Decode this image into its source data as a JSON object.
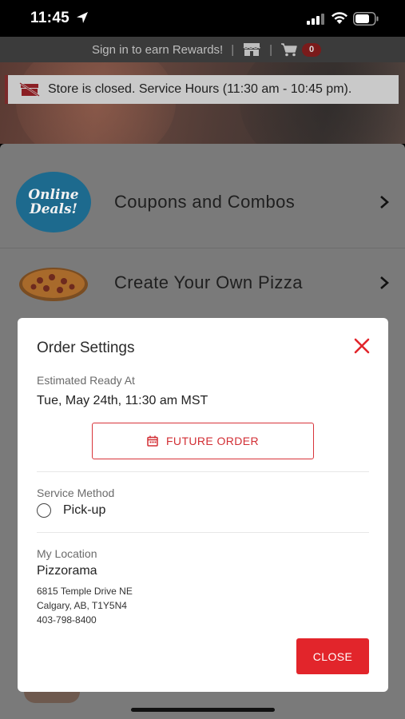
{
  "status_bar": {
    "time": "11:45"
  },
  "top_bar": {
    "signin_text": "Sign in to earn Rewards!",
    "separator": "|",
    "cart_count": "0"
  },
  "banner": {
    "text": "Store is closed. Service Hours (11:30 am - 10:45 pm)."
  },
  "menu": {
    "items": [
      {
        "label": "Coupons and Combos",
        "image_text_1": "Online",
        "image_text_2": "Deals!"
      },
      {
        "label": "Create Your Own Pizza"
      }
    ]
  },
  "modal": {
    "title": "Order Settings",
    "ready_label": "Estimated Ready At",
    "ready_value": "Tue, May 24th, 11:30 am MST",
    "future_button_label": "FUTURE ORDER",
    "service_label": "Service Method",
    "service_option": "Pick-up",
    "location_label": "My Location",
    "location_name": "Pizzorama",
    "address": [
      "6815 Temple Drive NE",
      "Calgary, AB, T1Y5N4",
      "403-798-8400"
    ],
    "close_button_label": "CLOSE"
  },
  "colors": {
    "accent_red": "#e2252b",
    "deals_blue": "#1d6a8e"
  },
  "icons": [
    "location-arrow-icon",
    "signal-icon",
    "wifi-icon",
    "battery-icon",
    "store-icon",
    "cart-icon",
    "store-closed-icon",
    "chevron-right-icon",
    "close-icon",
    "calendar-icon"
  ]
}
